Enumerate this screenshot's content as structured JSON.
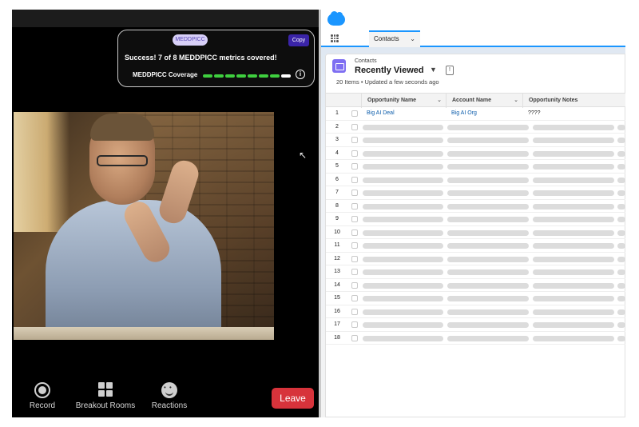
{
  "meddpicc": {
    "tag": "MEDDPICC",
    "copy_label": "Copy",
    "message": "Success! 7 of 8 MEDDPICC metrics covered!",
    "coverage_label": "MEDDPICC Coverage",
    "covered": 7,
    "total": 8,
    "colors": {
      "covered": "#3fcf3f",
      "uncovered": "#ffffff"
    }
  },
  "toolbar": {
    "record_label": "Record",
    "breakout_label": "Breakout Rooms",
    "reactions_label": "Reactions",
    "leave_label": "Leave"
  },
  "crm": {
    "nav_tab": "Contacts",
    "object_name": "Contacts",
    "view_name": "Recently Viewed",
    "meta": "20 Items • Updated a few seconds ago",
    "columns": [
      "Opportunity Name",
      "Account Name",
      "Opportunity Notes"
    ],
    "rows": [
      {
        "num": "1",
        "opportunity": "Big AI Deal",
        "account": "Big AI Org",
        "notes": "????"
      },
      {
        "num": "2"
      },
      {
        "num": "3"
      },
      {
        "num": "4"
      },
      {
        "num": "5"
      },
      {
        "num": "6"
      },
      {
        "num": "7"
      },
      {
        "num": "8"
      },
      {
        "num": "9"
      },
      {
        "num": "10"
      },
      {
        "num": "11"
      },
      {
        "num": "12"
      },
      {
        "num": "13"
      },
      {
        "num": "14"
      },
      {
        "num": "15"
      },
      {
        "num": "16"
      },
      {
        "num": "17"
      },
      {
        "num": "18"
      }
    ]
  }
}
